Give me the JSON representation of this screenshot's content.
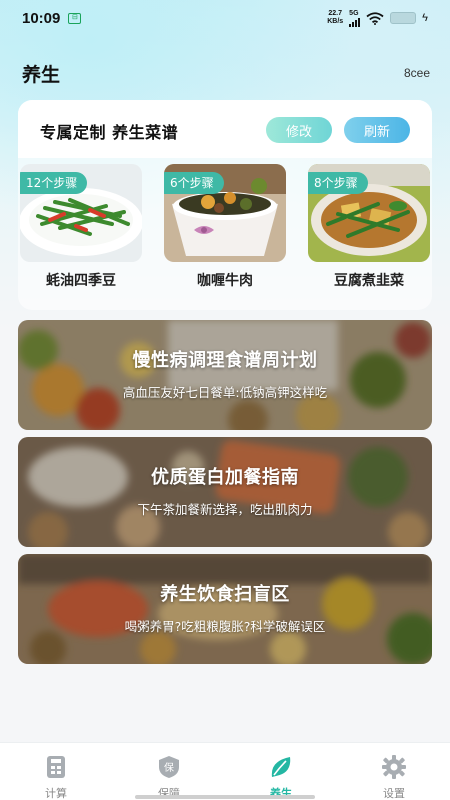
{
  "status_bar": {
    "time": "10:09",
    "app_icon": "notification-app-icon",
    "net_speed_value": "22.7",
    "net_speed_unit": "KB/s",
    "network": "5G",
    "battery_icon": "battery-icon",
    "charging_icon": "lightning-icon"
  },
  "header": {
    "title": "养生",
    "device_code": "8cee"
  },
  "recipe_panel": {
    "title": "专属定制 养生菜谱",
    "edit_label": "修改",
    "refresh_label": "刷新",
    "dishes": [
      {
        "badge": "12个步骤",
        "name": "蚝油四季豆"
      },
      {
        "badge": "6个步骤",
        "name": "咖喱牛肉"
      },
      {
        "badge": "8个步骤",
        "name": "豆腐煮韭菜"
      }
    ]
  },
  "banners": [
    {
      "title": "慢性病调理食谱周计划",
      "subtitle": "高血压友好七日餐单:低钠高钾这样吃"
    },
    {
      "title": "优质蛋白加餐指南",
      "subtitle": "下午茶加餐新选择，吃出肌肉力"
    },
    {
      "title": "养生饮食扫盲区",
      "subtitle": "喝粥养胃?吃粗粮腹胀?科学破解误区"
    }
  ],
  "bottom_nav": {
    "items": [
      {
        "label": "计算",
        "icon": "calculator-icon",
        "active": false
      },
      {
        "label": "保障",
        "icon": "shield-icon",
        "active": false
      },
      {
        "label": "养生",
        "icon": "leaf-icon",
        "active": true
      },
      {
        "label": "设置",
        "icon": "gear-icon",
        "active": false
      }
    ]
  },
  "colors": {
    "accent": "#24b7a3",
    "badge": "#3fb9a6",
    "refresh_button": "#4cb5e6",
    "edit_button": "#7fd9d4"
  }
}
